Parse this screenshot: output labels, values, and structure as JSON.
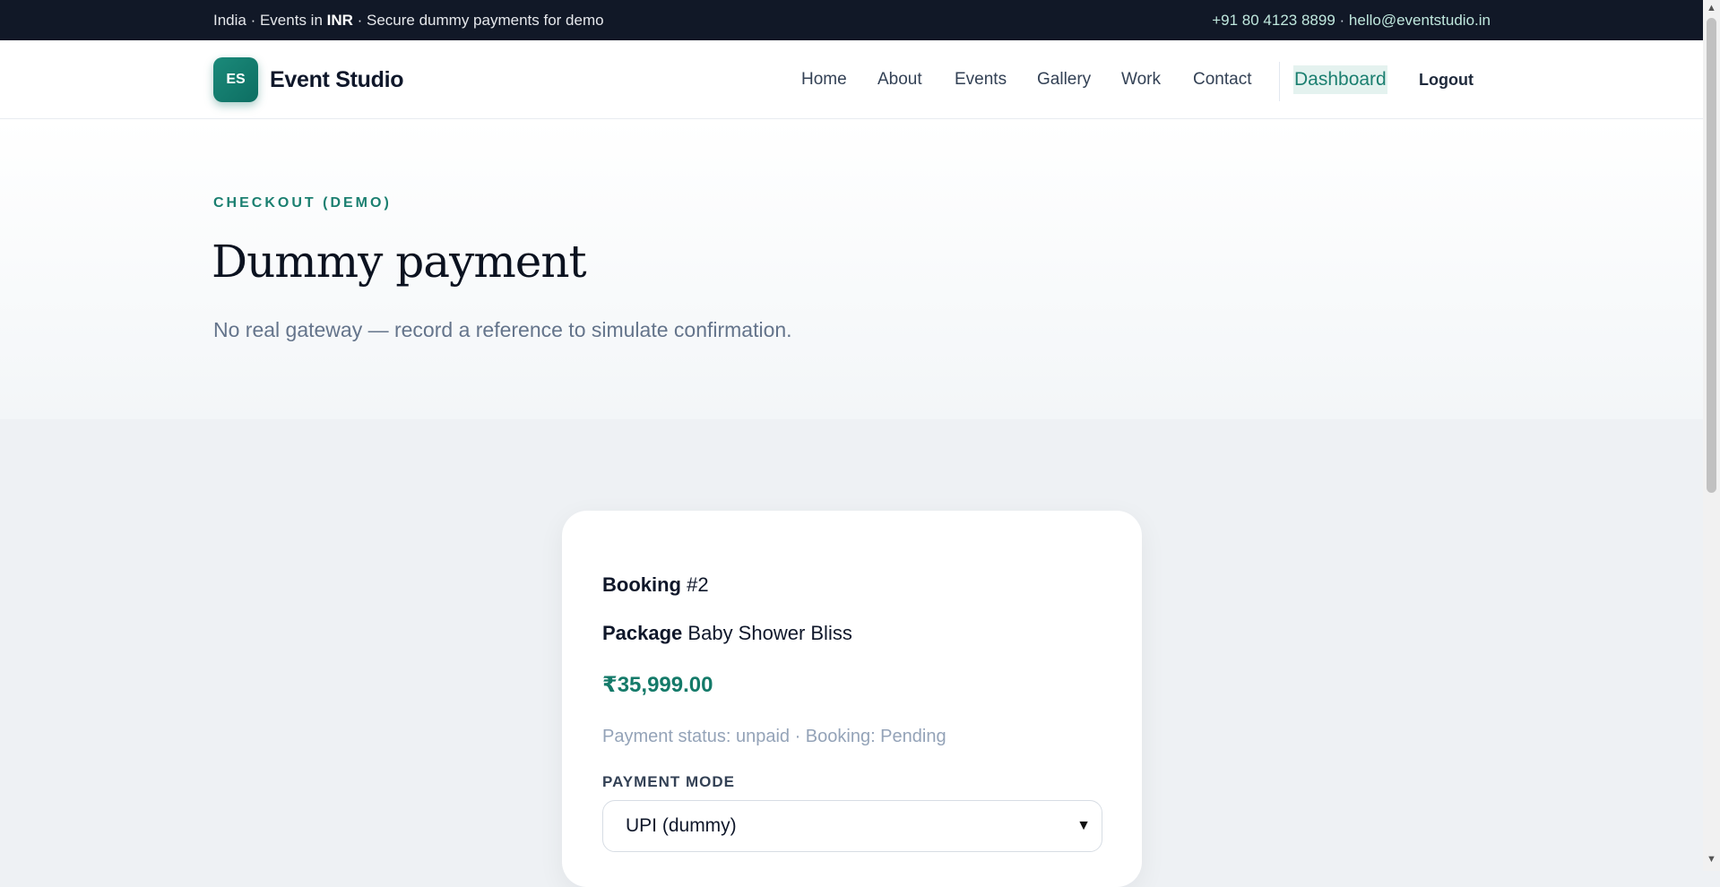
{
  "topbar": {
    "left_prefix": "India · Events in ",
    "left_bold": "INR",
    "left_suffix": " · Secure dummy payments for demo",
    "phone": "+91 80 4123 8899",
    "sep": " · ",
    "email": "hello@eventstudio.in"
  },
  "header": {
    "logo_initials": "ES",
    "brand": "Event Studio",
    "nav": [
      "Home",
      "About",
      "Events",
      "Gallery",
      "Work",
      "Contact"
    ],
    "dashboard": "Dashboard",
    "logout": "Logout"
  },
  "hero": {
    "eyebrow": "CHECKOUT (DEMO)",
    "title": "Dummy payment",
    "subtitle": "No real gateway — record a reference to simulate confirmation."
  },
  "card": {
    "booking_label": "Booking",
    "booking_value": "#2",
    "package_label": "Package",
    "package_value": "Baby Shower Bliss",
    "amount": "₹35,999.00",
    "status": "Payment status: unpaid · Booking: Pending",
    "payment_mode_label": "PAYMENT MODE",
    "payment_mode_value": "UPI (dummy)"
  },
  "colors": {
    "accent": "#1b7f70",
    "topbar": "#111827"
  }
}
